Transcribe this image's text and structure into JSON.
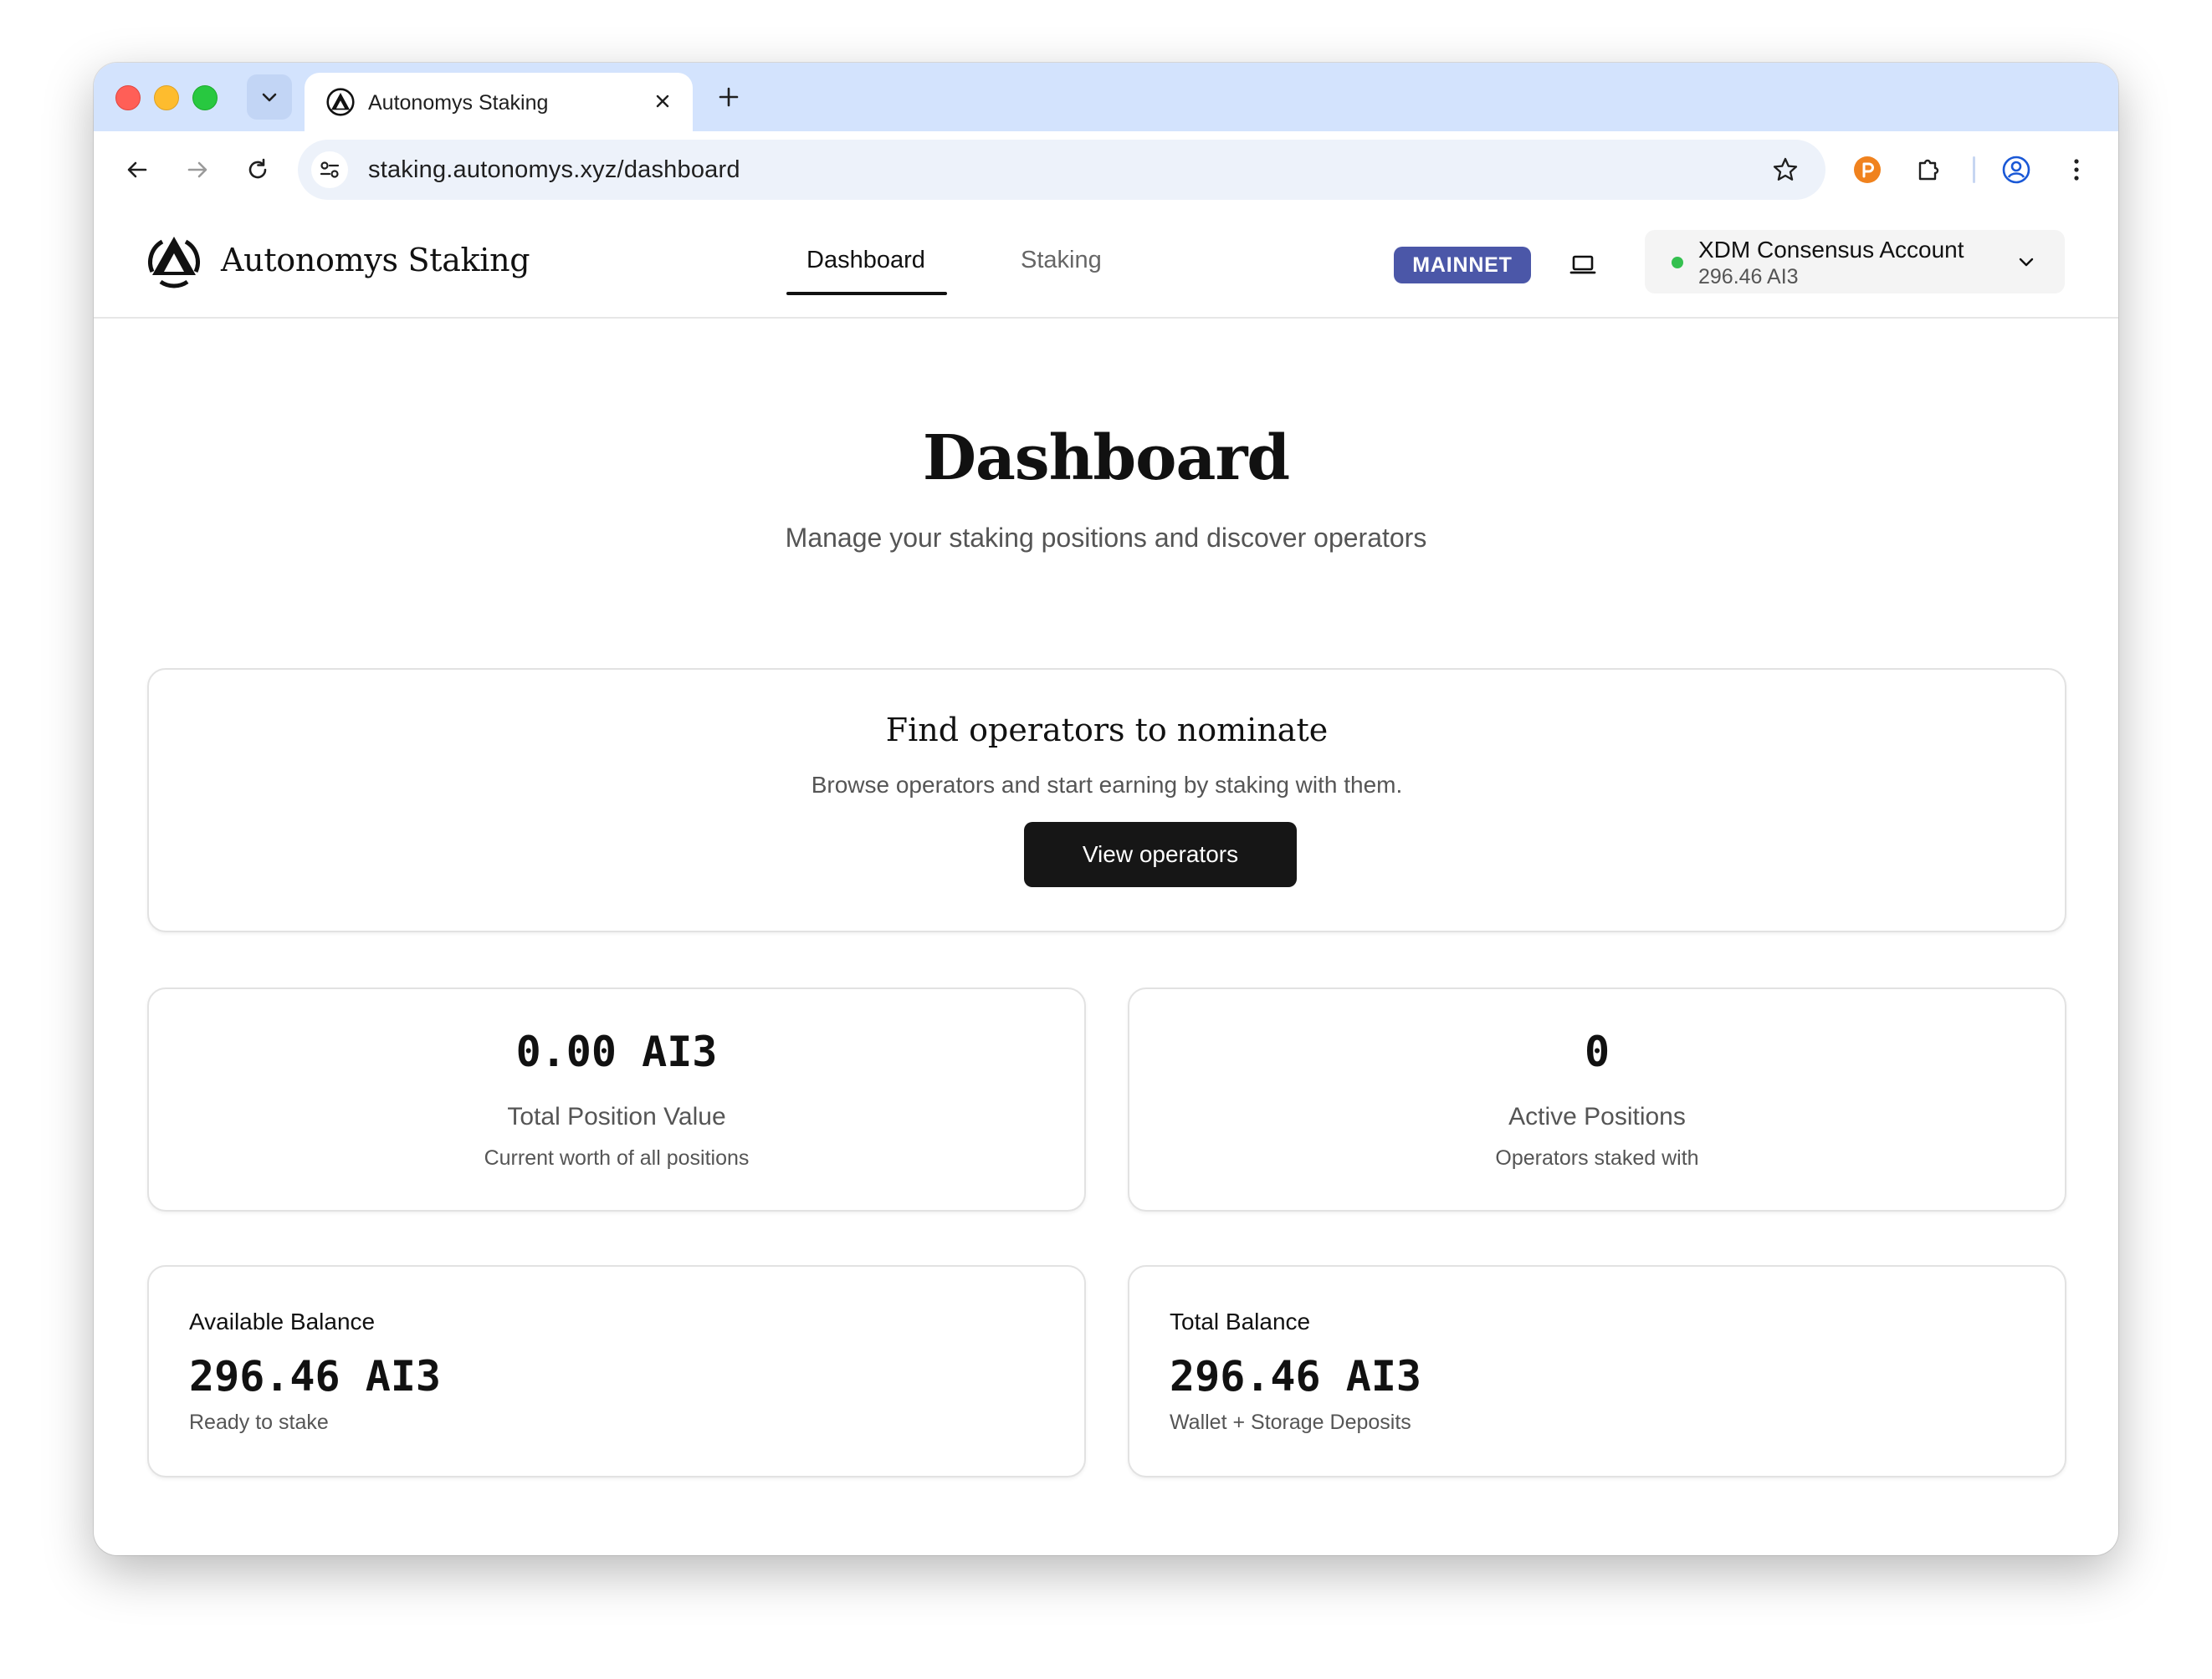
{
  "browser": {
    "tab_title": "Autonomys Staking",
    "url": "staking.autonomys.xyz/dashboard",
    "icons": [
      "tab-search-icon",
      "close-icon",
      "plus-icon",
      "back-icon",
      "forward-icon",
      "reload-icon",
      "tune-icon",
      "star-icon",
      "extension-icon",
      "puzzle-icon",
      "profile-icon",
      "more-icon"
    ]
  },
  "header": {
    "brand": "Autonomys Staking",
    "nav": [
      {
        "label": "Dashboard",
        "active": true
      },
      {
        "label": "Staking",
        "active": false
      }
    ],
    "network_badge": "MAINNET",
    "account": {
      "name": "XDM Consensus Account",
      "balance": "296.46 AI3",
      "status_color": "#34c04f"
    }
  },
  "main": {
    "title": "Dashboard",
    "subtitle": "Manage your staking positions and discover operators",
    "cta": {
      "title": "Find operators to nominate",
      "text": "Browse operators and start earning by staking with them.",
      "button": "View operators"
    },
    "stats": [
      {
        "value": "0.00 AI3",
        "label": "Total Position Value",
        "description": "Current worth of all positions"
      },
      {
        "value": "0",
        "label": "Active Positions",
        "description": "Operators staked with"
      }
    ],
    "balances": [
      {
        "title": "Available Balance",
        "value": "296.46 AI3",
        "subtitle": "Ready to stake"
      },
      {
        "title": "Total Balance",
        "value": "296.46 AI3",
        "subtitle": "Wallet + Storage Deposits"
      }
    ]
  },
  "colors": {
    "accent_badge": "#4b57a8",
    "primary_button": "#161616",
    "tab_strip": "#d3e3fd"
  }
}
